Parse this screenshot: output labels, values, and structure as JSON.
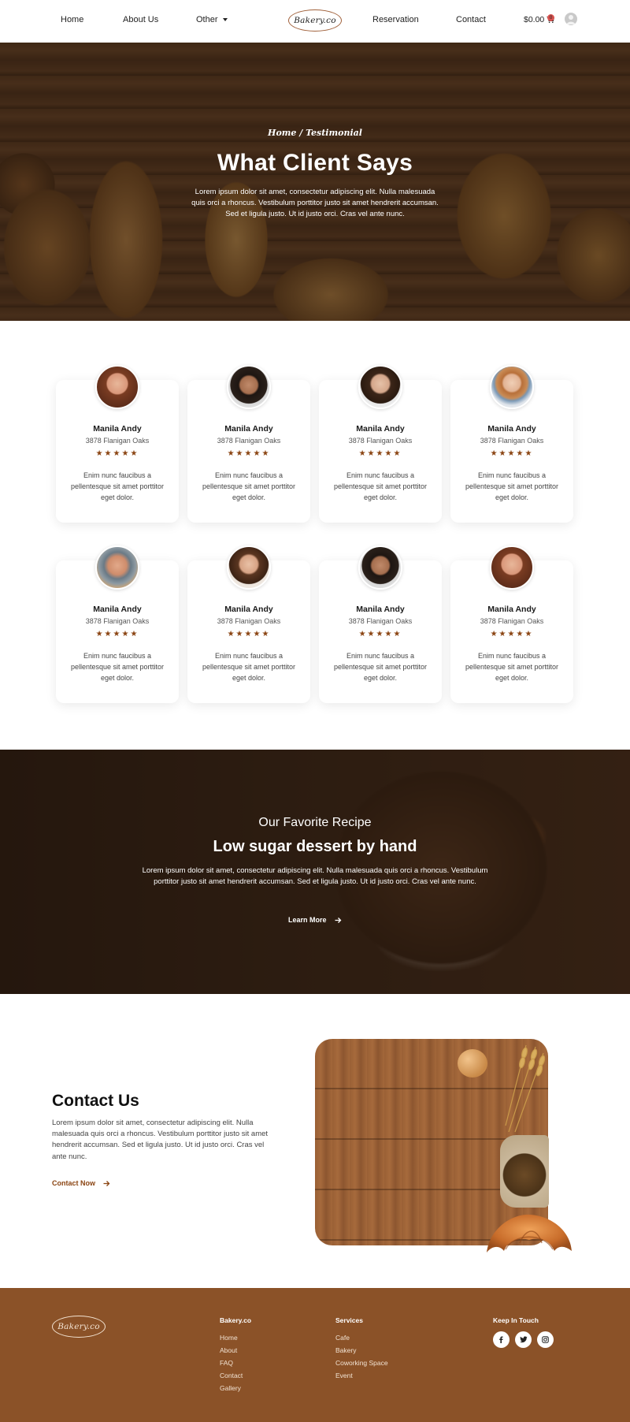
{
  "nav": {
    "home": "Home",
    "about": "About Us",
    "other": "Other",
    "logo": "Bakery.co",
    "reservation": "Reservation",
    "contact": "Contact",
    "cart_total": "$0.00",
    "cart_count": "0"
  },
  "hero": {
    "breadcrumb": "Home / Testimonial",
    "title": "What Client Says",
    "text": "Lorem ipsum dolor sit amet, consectetur adipiscing elit. Nulla malesuada quis orci a rhoncus. Vestibulum porttitor justo sit amet hendrerit accumsan. Sed et ligula justo. Ut id justo orci. Cras vel ante nunc."
  },
  "testimonials": [
    {
      "name": "Manila Andy",
      "location": "3878 Flanigan Oaks",
      "stars": "★★★★★",
      "rating": 5,
      "text": "Enim nunc faucibus a pellentesque sit amet porttitor eget dolor."
    },
    {
      "name": "Manila Andy",
      "location": "3878 Flanigan Oaks",
      "stars": "★★★★★",
      "rating": 5,
      "text": "Enim nunc faucibus a pellentesque sit amet porttitor eget dolor."
    },
    {
      "name": "Manila Andy",
      "location": "3878 Flanigan Oaks",
      "stars": "★★★★★",
      "rating": 5,
      "text": "Enim nunc faucibus a pellentesque sit amet porttitor eget dolor."
    },
    {
      "name": "Manila Andy",
      "location": "3878 Flanigan Oaks",
      "stars": "★★★★★",
      "rating": 5,
      "text": "Enim nunc faucibus a pellentesque sit amet porttitor eget dolor."
    },
    {
      "name": "Manila Andy",
      "location": "3878 Flanigan Oaks",
      "stars": "★★★★★",
      "rating": 5,
      "text": "Enim nunc faucibus a pellentesque sit amet porttitor eget dolor."
    },
    {
      "name": "Manila Andy",
      "location": "3878 Flanigan Oaks",
      "stars": "★★★★★",
      "rating": 5,
      "text": "Enim nunc faucibus a pellentesque sit amet porttitor eget dolor."
    },
    {
      "name": "Manila Andy",
      "location": "3878 Flanigan Oaks",
      "stars": "★★★★★",
      "rating": 5,
      "text": "Enim nunc faucibus a pellentesque sit amet porttitor eget dolor."
    },
    {
      "name": "Manila Andy",
      "location": "3878 Flanigan Oaks",
      "stars": "★★★★★",
      "rating": 5,
      "text": "Enim nunc faucibus a pellentesque sit amet porttitor eget dolor."
    }
  ],
  "recipe": {
    "subtitle": "Our Favorite Recipe",
    "title": "Low sugar dessert by hand",
    "text": "Lorem ipsum dolor sit amet, consectetur adipiscing elit. Nulla malesuada quis orci a rhoncus. Vestibulum porttitor justo sit amet hendrerit accumsan. Sed et ligula justo. Ut id justo orci. Cras vel ante nunc.",
    "link": "Learn More"
  },
  "contact": {
    "title": "Contact Us",
    "text": "Lorem ipsum dolor sit amet, consectetur adipiscing elit. Nulla malesuada quis orci a rhoncus. Vestibulum porttitor justo sit amet hendrerit accumsan. Sed et ligula justo. Ut id justo orci. Cras vel ante nunc.",
    "link": "Contact Now"
  },
  "footer": {
    "logo": "Bakery.co",
    "col1": {
      "heading": "Bakery.co",
      "items": [
        "Home",
        "About",
        "FAQ",
        "Contact",
        "Gallery"
      ]
    },
    "col2": {
      "heading": "Services",
      "items": [
        "Cafe",
        "Bakery",
        "Coworking Space",
        "Event"
      ]
    },
    "col3": {
      "heading": "Keep In Touch"
    },
    "socials": [
      "facebook-icon",
      "twitter-icon",
      "instagram-icon"
    ]
  },
  "colors": {
    "accent": "#8b4513",
    "footer_bg": "#8b5228",
    "star": "#8b4513"
  }
}
